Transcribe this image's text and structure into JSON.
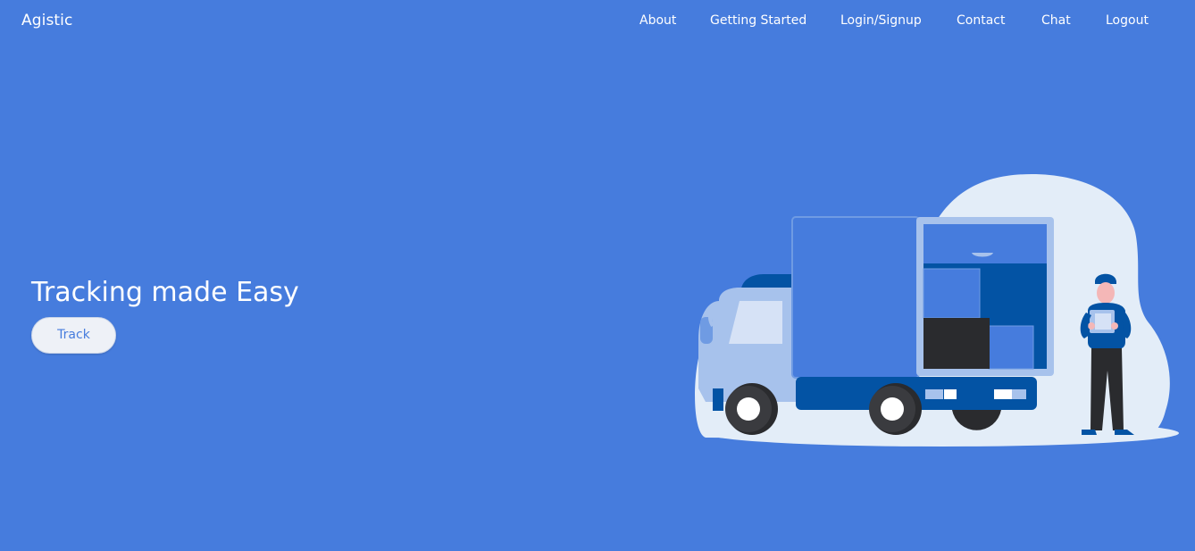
{
  "brand": {
    "name": "Agistic"
  },
  "nav": {
    "items": [
      {
        "label": "About"
      },
      {
        "label": "Getting Started"
      },
      {
        "label": "Login/Signup"
      },
      {
        "label": "Contact"
      },
      {
        "label": "Chat"
      },
      {
        "label": "Logout"
      }
    ]
  },
  "hero": {
    "title": "Tracking made Easy",
    "button_label": "Track",
    "illustration": "delivery-truck-with-courier-illustration"
  },
  "colors": {
    "background": "#467cdd",
    "text": "#ffffff",
    "button_bg": "#eef1f7",
    "button_text": "#467cdd",
    "illustration_blob": "#e3edf8",
    "truck_dark_blue": "#0353a4",
    "truck_light_blue": "#a7c2ec",
    "box_dark": "#2a2b2e"
  }
}
